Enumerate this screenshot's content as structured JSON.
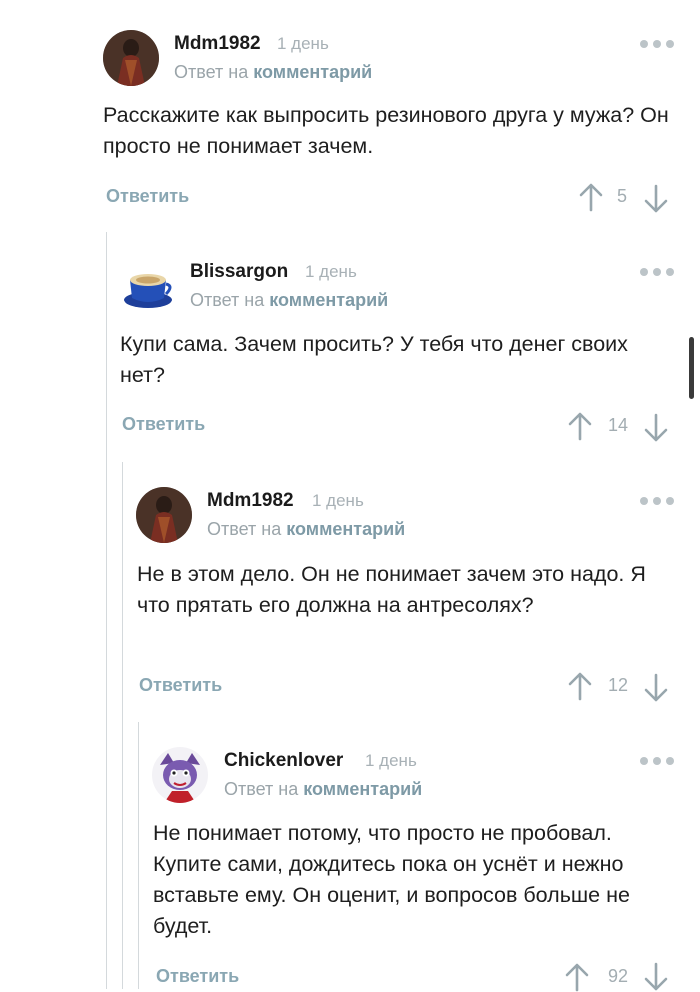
{
  "labels": {
    "reply_to_prefix": "Ответ на",
    "reply_to_link": "комментарий",
    "reply_button": "Ответить"
  },
  "comments": [
    {
      "author": "Mdm1982",
      "time": "1 день",
      "text": "Расскажите как выпросить резинового друга у мужа? Он просто не понимает зачем.",
      "rating": "5",
      "avatar": "dark-figure-avatar"
    },
    {
      "author": "Blissargon",
      "time": "1 день",
      "text": "Купи сама. Зачем просить? У тебя что денег своих нет?",
      "rating": "14",
      "avatar": "coffee-cup-avatar"
    },
    {
      "author": "Mdm1982",
      "time": "1 день",
      "text": "Не в этом дело. Он не понимает зачем это надо. Я что прятать его должна на антресолях?",
      "rating": "12",
      "avatar": "dark-figure-avatar"
    },
    {
      "author": "Chickenlover",
      "time": "1 день",
      "text": "Не понимает потому, что просто не пробовал. Купите сами, дождитесь пока он уснёт и нежно вставьте ему. Он оценит, и вопросов больше не будет.",
      "rating": "92",
      "avatar": "cartoon-character-avatar"
    }
  ],
  "colors": {
    "accent": "#8aa7b3",
    "muted": "#a8b1b6",
    "thread_line": "#d4d9dc"
  }
}
